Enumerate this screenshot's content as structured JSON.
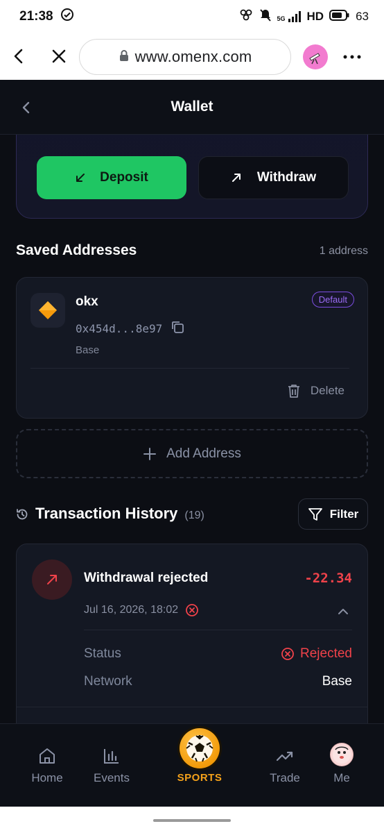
{
  "status_bar": {
    "time": "21:38",
    "network": "5G",
    "hd": "HD",
    "battery": "63"
  },
  "browser": {
    "url": "www.omenx.com"
  },
  "header": {
    "title": "Wallet"
  },
  "actions": {
    "deposit_label": "Deposit",
    "withdraw_label": "Withdraw"
  },
  "saved_addresses": {
    "title": "Saved Addresses",
    "count_text": "1 address",
    "items": [
      {
        "name": "okx",
        "address": "0x454d...8e97",
        "network": "Base",
        "badge": "Default",
        "delete_label": "Delete"
      }
    ],
    "add_label": "Add Address"
  },
  "transactions": {
    "title": "Transaction History",
    "count": "(19)",
    "filter_label": "Filter",
    "items": [
      {
        "name": "Withdrawal rejected",
        "amount": "-22.34",
        "date": "Jul 16, 2026, 18:02",
        "status_label": "Status",
        "status_value": "Rejected",
        "network_label": "Network",
        "network_value": "Base"
      }
    ]
  },
  "bottom_nav": {
    "home": "Home",
    "events": "Events",
    "sports": "SPORTS",
    "trade": "Trade",
    "me": "Me"
  },
  "colors": {
    "accent_green": "#1fc663",
    "negative_red": "#f0424a",
    "sports_orange": "#f4a11a",
    "badge_purple": "#9b6cf5"
  }
}
